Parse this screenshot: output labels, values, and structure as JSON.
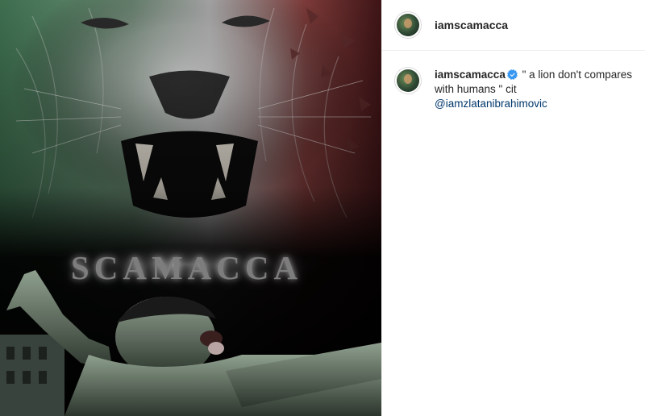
{
  "post": {
    "image_text": "SCAMACCA",
    "image_alt_icon": "lion-poster-image"
  },
  "header": {
    "username": "iamscamacca"
  },
  "caption": {
    "username": "iamscamacca",
    "verified_icon": "verified-badge-icon",
    "text": "\" a lion don't compares with humans \" cit",
    "mention": "@iamzlatanibrahimovic"
  },
  "colors": {
    "verified": "#3897f0",
    "mention": "#00376b",
    "text": "#262626"
  }
}
